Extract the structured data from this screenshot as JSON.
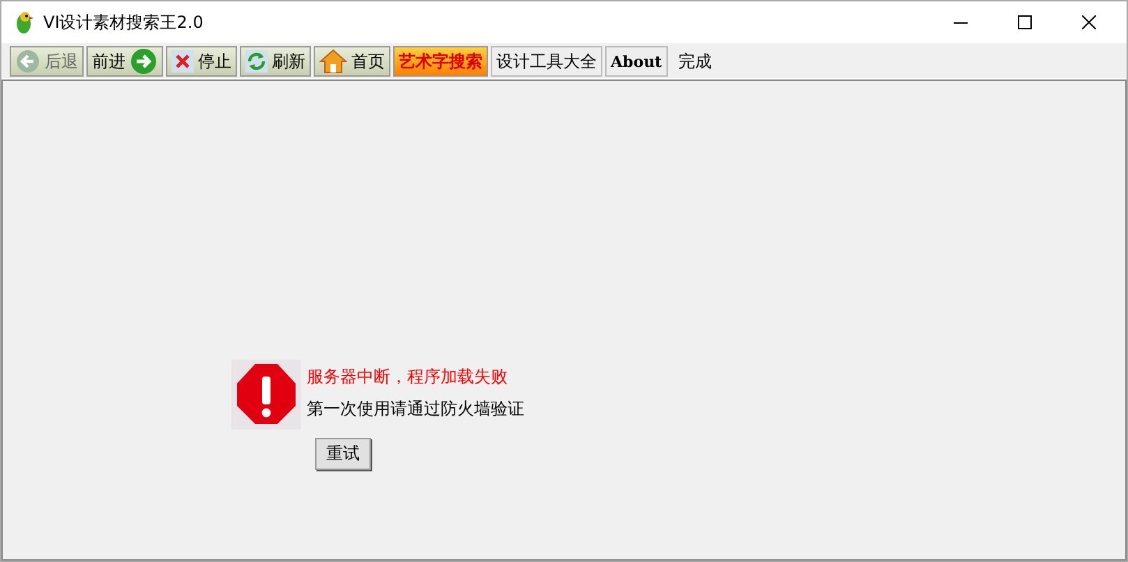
{
  "window": {
    "title": "VI设计素材搜索王2.0"
  },
  "toolbar": [
    {
      "label": "后退",
      "kind": "back",
      "disabled": true
    },
    {
      "label": "前进",
      "kind": "forward",
      "disabled": false
    },
    {
      "label": "停止",
      "kind": "stop",
      "disabled": false
    },
    {
      "label": "刷新",
      "kind": "refresh",
      "disabled": false
    },
    {
      "label": "首页",
      "kind": "home",
      "disabled": false
    },
    {
      "label": "艺术字搜索",
      "kind": "highlight",
      "disabled": false
    },
    {
      "label": "设计工具大全",
      "kind": "plain",
      "disabled": false
    },
    {
      "label": "About",
      "kind": "plain",
      "disabled": false
    }
  ],
  "status": "完成",
  "error": {
    "title": "服务器中断，程序加载失败",
    "message": "第一次使用请通过防火墙验证",
    "button": "重试"
  }
}
